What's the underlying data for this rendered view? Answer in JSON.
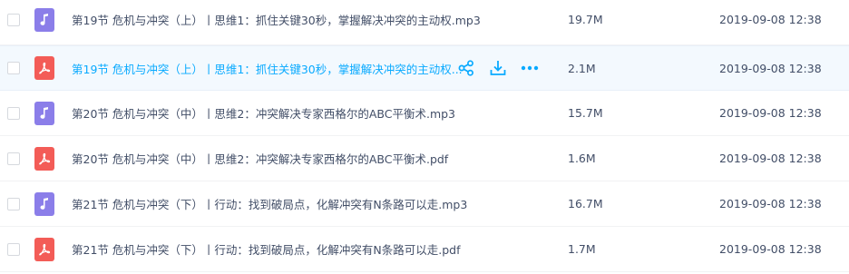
{
  "files": [
    {
      "name": "第19节 危机与冲突（上）丨思维1：抓住关键30秒，掌握解决冲突的主动权.mp3",
      "type": "mp3",
      "size": "19.7M",
      "date": "2019-09-08 12:38",
      "icon": "music-note-icon"
    },
    {
      "name": "第19节 危机与冲突（上）丨思维1：抓住关键30秒，掌握解决冲突的主动权...",
      "type": "pdf",
      "size": "2.1M",
      "date": "2019-09-08 12:38",
      "icon": "pdf-icon"
    },
    {
      "name": "第20节 危机与冲突（中）丨思维2：冲突解决专家西格尔的ABC平衡术.mp3",
      "type": "mp3",
      "size": "15.7M",
      "date": "2019-09-08 12:38",
      "icon": "music-note-icon"
    },
    {
      "name": "第20节 危机与冲突（中）丨思维2：冲突解决专家西格尔的ABC平衡术.pdf",
      "type": "pdf",
      "size": "1.6M",
      "date": "2019-09-08 12:38",
      "icon": "pdf-icon"
    },
    {
      "name": "第21节 危机与冲突（下）丨行动：找到破局点，化解冲突有N条路可以走.mp3",
      "type": "mp3",
      "size": "16.7M",
      "date": "2019-09-08 12:38",
      "icon": "music-note-icon"
    },
    {
      "name": "第21节 危机与冲突（下）丨行动：找到破局点，化解冲突有N条路可以走.pdf",
      "type": "pdf",
      "size": "1.7M",
      "date": "2019-09-08 12:38",
      "icon": "pdf-icon"
    }
  ],
  "hover_actions": {
    "share_icon": "share-icon",
    "download_icon": "download-icon",
    "more_icon": "more-icon"
  },
  "colors": {
    "accent": "#09aaff",
    "mp3_icon_bg": "#8b7ee9",
    "pdf_icon_bg": "#f35c57",
    "hover_row_bg": "#f3f9fe",
    "text": "#424e67"
  }
}
